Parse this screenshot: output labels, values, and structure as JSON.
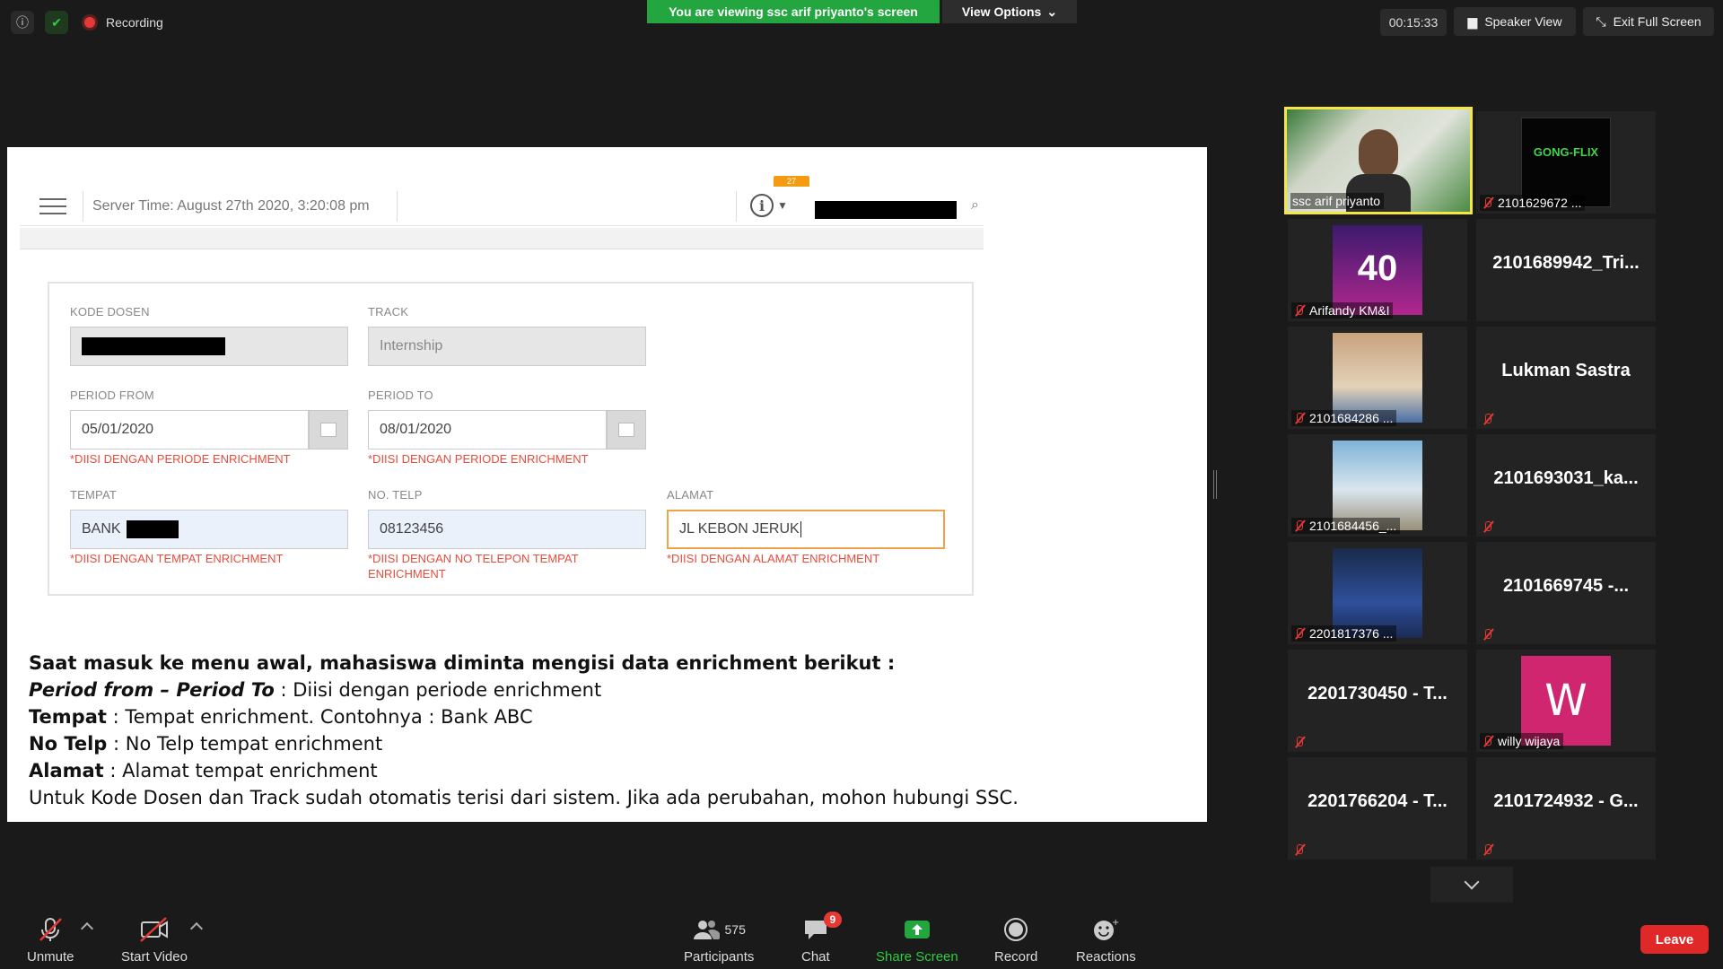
{
  "topbar": {
    "recording_label": "Recording",
    "viewing_banner": "You are viewing ssc arif priyanto's screen",
    "view_options": "View Options",
    "timer": "00:15:33",
    "speaker_view": "Speaker View",
    "exit_full_screen": "Exit Full Screen"
  },
  "shared_app": {
    "server_time": "Server Time: August 27th 2020, 3:20:08 pm",
    "notif_badge": "27",
    "form": {
      "kode_dosen_label": "KODE DOSEN",
      "track_label": "TRACK",
      "track_value": "Internship",
      "period_from_label": "PERIOD FROM",
      "period_from_value": "05/01/2020",
      "period_from_error": "*DIISI DENGAN PERIODE ENRICHMENT",
      "period_to_label": "PERIOD TO",
      "period_to_value": "08/01/2020",
      "period_to_error": "*DIISI DENGAN PERIODE ENRICHMENT",
      "tempat_label": "TEMPAT",
      "tempat_value": "BANK",
      "tempat_error": "*DIISI DENGAN TEMPAT ENRICHMENT",
      "telp_label": "NO. TELP",
      "telp_value": "08123456",
      "telp_error_1": "*DIISI DENGAN NO TELEPON TEMPAT",
      "telp_error_2": "ENRICHMENT",
      "alamat_label": "ALAMAT",
      "alamat_value": "JL KEBON JERUK",
      "alamat_error": "*DIISI DENGAN ALAMAT ENRICHMENT"
    },
    "instructions": {
      "line1": "Saat masuk ke menu awal, mahasiswa diminta mengisi data enrichment berikut :",
      "l2_key": "Period from – Period To",
      "l2_val": " : Diisi dengan periode enrichment",
      "l3_key": "Tempat",
      "l3_val": " : Tempat enrichment. Contohnya : Bank ABC",
      "l4_key": "No Telp",
      "l4_val": " : No Telp tempat enrichment",
      "l5_key": "Alamat",
      "l5_val": " : Alamat tempat enrichment",
      "line6": "Untuk Kode Dosen dan Track sudah otomatis terisi dari sistem. Jika ada perubahan, mohon hubungi SSC."
    }
  },
  "gallery": {
    "tiles": [
      {
        "label": "ssc arif priyanto"
      },
      {
        "label": "2101629672 ..."
      },
      {
        "label": "Arifandy KM&I"
      },
      {
        "name": "2101689942_Tri..."
      },
      {
        "label": "2101684286 ..."
      },
      {
        "name": "Lukman Sastra"
      },
      {
        "label": "2101684456_..."
      },
      {
        "name": "2101693031_ka..."
      },
      {
        "label": "2201817376 ..."
      },
      {
        "name": "2101669745 -..."
      },
      {
        "name": "2201730450 - T..."
      },
      {
        "label": "willy wijaya",
        "avatar_letter": "W"
      },
      {
        "name": "2201766204 - T..."
      },
      {
        "name": "2101724932 - G..."
      }
    ]
  },
  "bottombar": {
    "unmute": "Unmute",
    "start_video": "Start Video",
    "participants": "Participants",
    "participants_count": "575",
    "chat": "Chat",
    "chat_badge": "9",
    "share_screen": "Share Screen",
    "record": "Record",
    "reactions": "Reactions",
    "leave": "Leave"
  },
  "colors": {
    "banner_green": "#23a540",
    "active_speaker": "#f5e742",
    "error_red": "#e74c3c",
    "leave_red": "#e02828"
  }
}
